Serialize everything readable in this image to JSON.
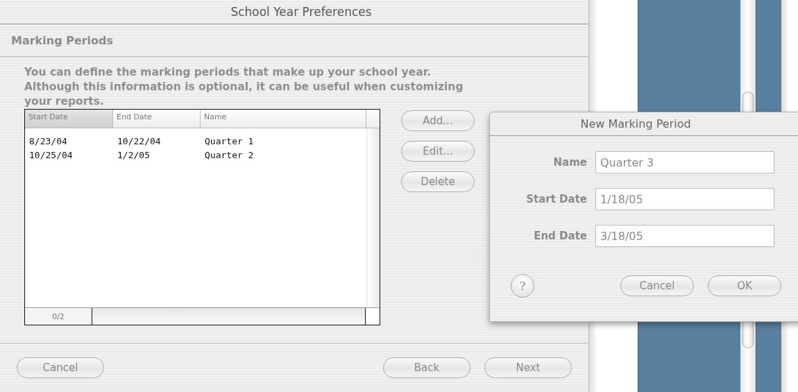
{
  "window": {
    "title": "School Year Preferences"
  },
  "section": {
    "title": "Marking Periods"
  },
  "description": "You can define the marking periods that make up your school year. Although this information is optional, it can be useful when customizing your reports.",
  "table": {
    "columns": [
      {
        "label": "Start Date",
        "selected": true
      },
      {
        "label": "End Date",
        "selected": false
      },
      {
        "label": "Name",
        "selected": false
      }
    ],
    "rows": [
      [
        "8/23/04",
        "10/22/04",
        "Quarter 1"
      ],
      [
        "10/25/04",
        "1/2/05",
        "Quarter 2"
      ]
    ],
    "record_count": "0/2"
  },
  "side_buttons": [
    "Add...",
    "Edit...",
    "Delete"
  ],
  "footer_buttons": {
    "left": [
      "Cancel"
    ],
    "right": [
      "Back",
      "Next"
    ]
  },
  "dialog": {
    "title": "New Marking Period",
    "fields": [
      {
        "label": "Name",
        "value": "Quarter 3"
      },
      {
        "label": "Start Date",
        "value": "1/18/05"
      },
      {
        "label": "End Date",
        "value": "3/18/05"
      }
    ],
    "help": "?",
    "buttons": [
      "Cancel",
      "OK"
    ]
  }
}
